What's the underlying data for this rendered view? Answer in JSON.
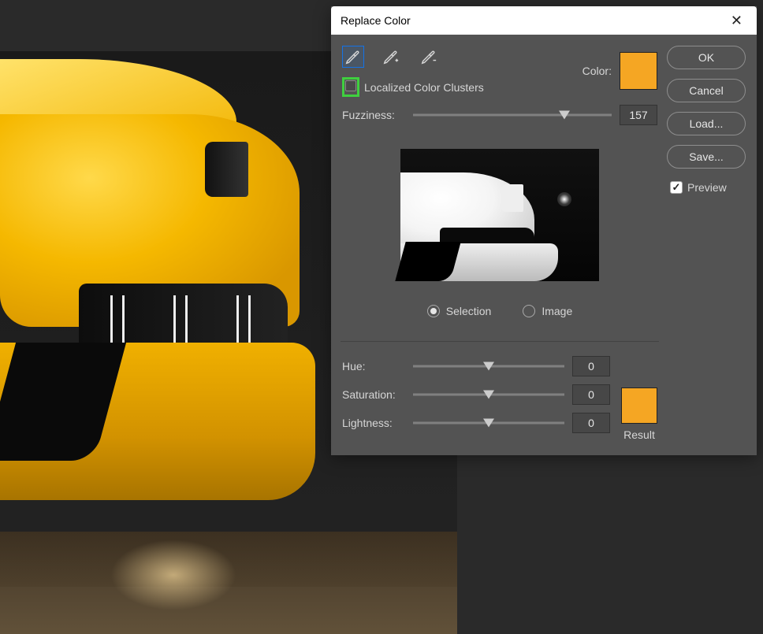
{
  "dialog": {
    "title": "Replace Color",
    "localized_label": "Localized Color Clusters",
    "fuzziness_label": "Fuzziness:",
    "fuzziness_value": "157",
    "color_label": "Color:",
    "selection_label": "Selection",
    "image_label": "Image",
    "hue_label": "Hue:",
    "hue_value": "0",
    "saturation_label": "Saturation:",
    "saturation_value": "0",
    "lightness_label": "Lightness:",
    "lightness_value": "0",
    "result_label": "Result",
    "preview_label": "Preview",
    "color_swatch": "#f5a623",
    "result_swatch": "#f5a623"
  },
  "buttons": {
    "ok": "OK",
    "cancel": "Cancel",
    "load": "Load...",
    "save": "Save..."
  }
}
